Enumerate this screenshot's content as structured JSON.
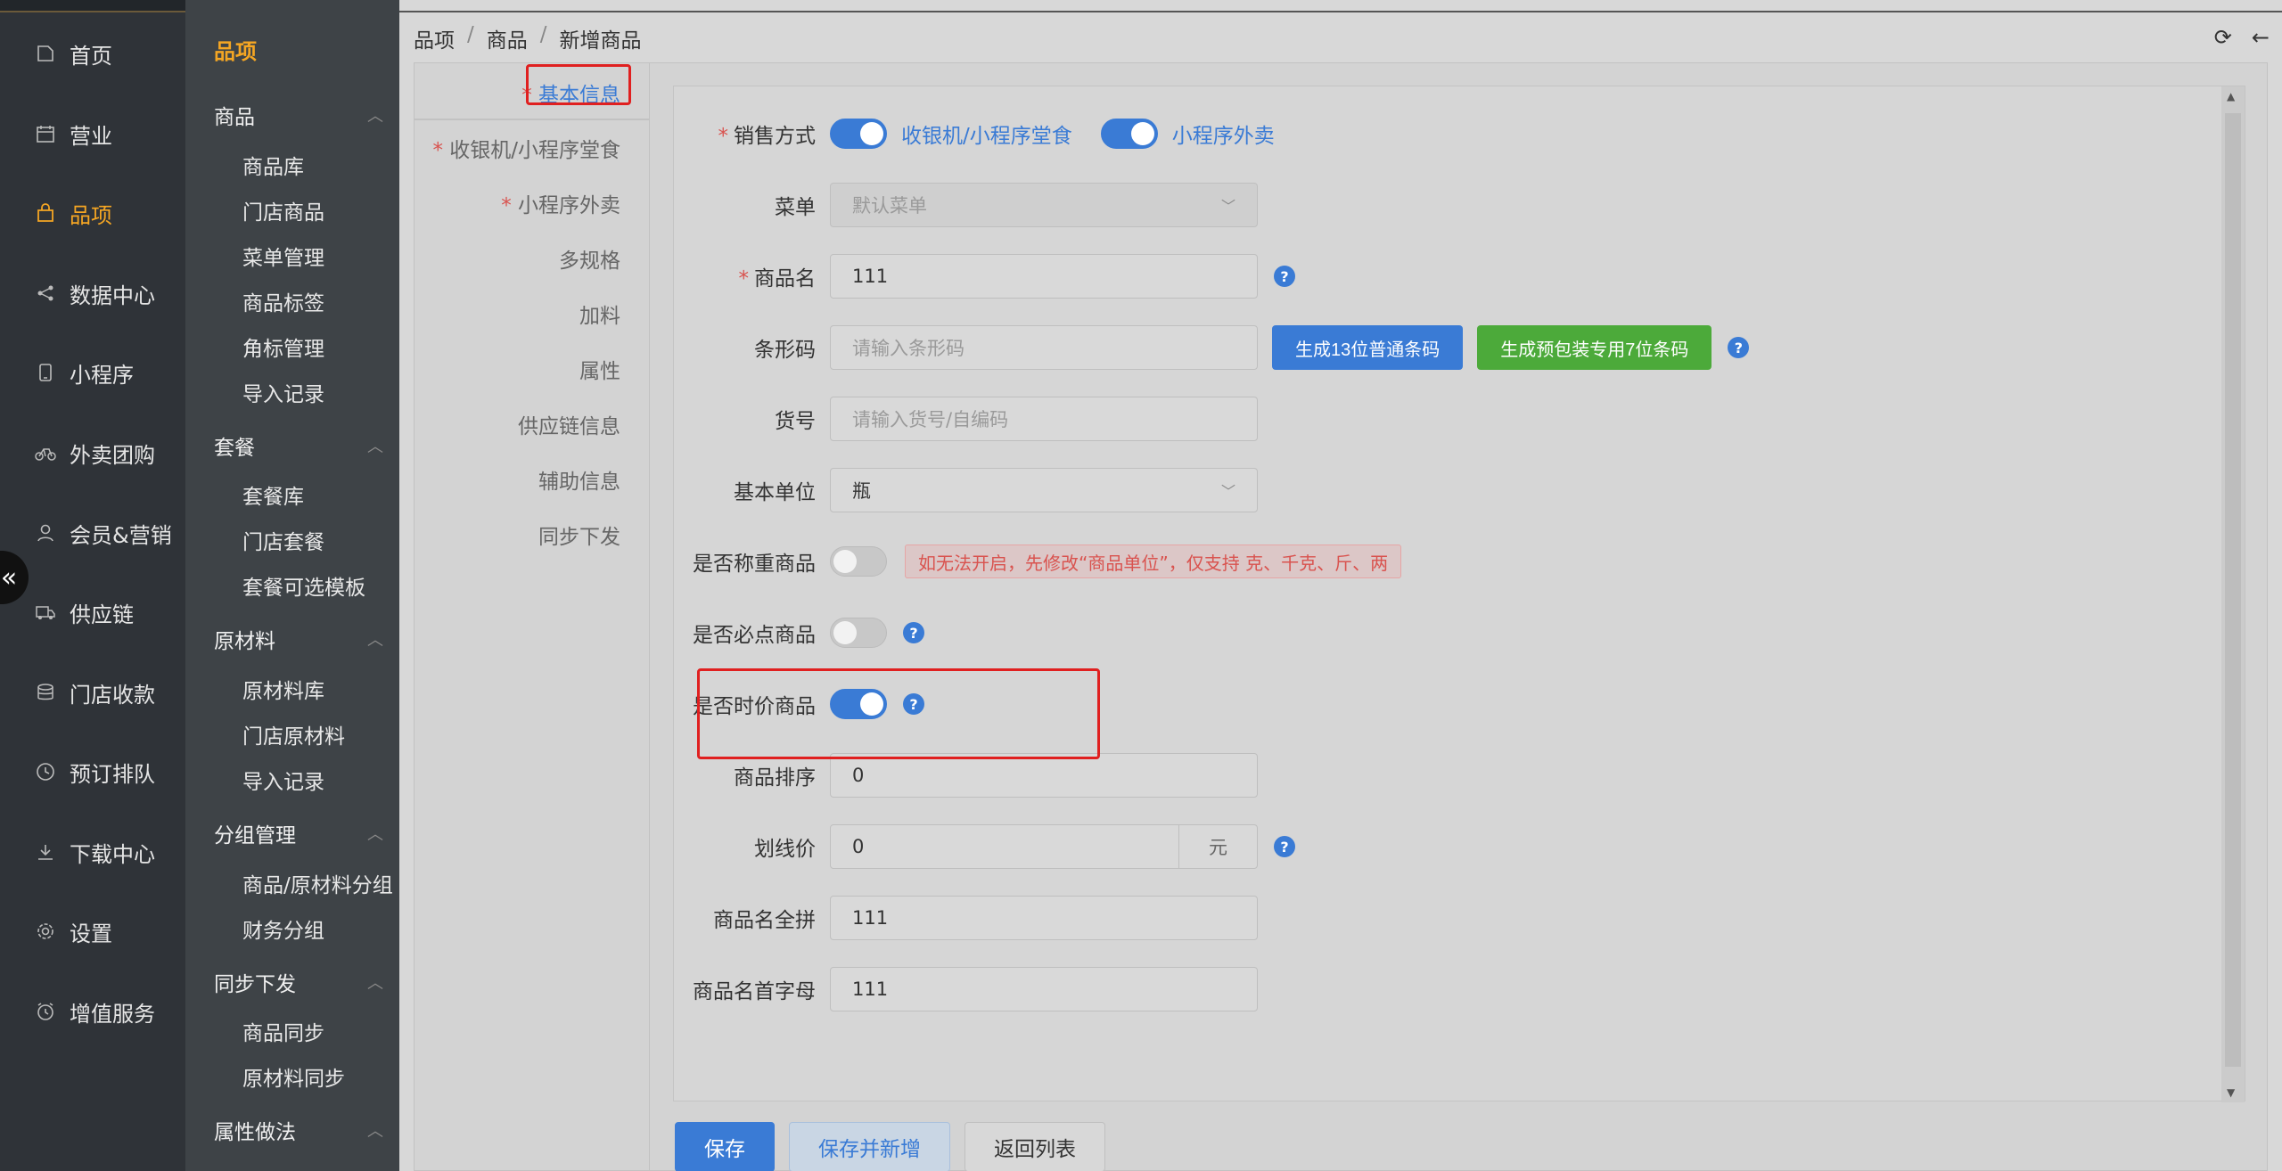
{
  "nav1": {
    "items": [
      {
        "label": "首页",
        "icon": "home-icon"
      },
      {
        "label": "营业",
        "icon": "calendar-icon"
      },
      {
        "label": "品项",
        "icon": "bag-icon"
      },
      {
        "label": "数据中心",
        "icon": "share-icon"
      },
      {
        "label": "小程序",
        "icon": "phone-icon"
      },
      {
        "label": "外卖团购",
        "icon": "bike-icon"
      },
      {
        "label": "会员&营销",
        "icon": "user-icon"
      },
      {
        "label": "供应链",
        "icon": "truck-icon"
      },
      {
        "label": "门店收款",
        "icon": "database-icon"
      },
      {
        "label": "预订排队",
        "icon": "clock-icon"
      },
      {
        "label": "下载中心",
        "icon": "download-icon"
      },
      {
        "label": "设置",
        "icon": "gear-icon"
      },
      {
        "label": "增值服务",
        "icon": "alarm-icon"
      }
    ],
    "collapse": "«"
  },
  "nav2": {
    "title": "品项",
    "groups": {
      "goods": "商品",
      "combo": "套餐",
      "material": "原材料",
      "grouping": "分组管理",
      "sync": "同步下发",
      "attr": "属性做法"
    },
    "items": {
      "goods_lib": "商品库",
      "store_goods": "门店商品",
      "menu_mgmt": "菜单管理",
      "goods_tags": "商品标签",
      "corner_mgmt": "角标管理",
      "import_record": "导入记录",
      "combo_lib": "套餐库",
      "store_combo": "门店套餐",
      "combo_template": "套餐可选模板",
      "material_lib": "原材料库",
      "store_material": "门店原材料",
      "import_record2": "导入记录",
      "goods_material_group": "商品/原材料分组",
      "finance_group": "财务分组",
      "goods_sync": "商品同步",
      "material_sync": "原材料同步"
    }
  },
  "breadcrumb": [
    "品项",
    "商品",
    "新增商品"
  ],
  "tabs": [
    {
      "label": "基本信息",
      "required": true
    },
    {
      "label": "收银机/小程序堂食",
      "required": true
    },
    {
      "label": "小程序外卖",
      "required": true
    },
    {
      "label": "多规格",
      "required": false
    },
    {
      "label": "加料",
      "required": false
    },
    {
      "label": "属性",
      "required": false
    },
    {
      "label": "供应链信息",
      "required": false
    },
    {
      "label": "辅助信息",
      "required": false
    },
    {
      "label": "同步下发",
      "required": false
    }
  ],
  "form": {
    "sale_mode": {
      "label": "销售方式",
      "opt1": "收银机/小程序堂食",
      "opt2": "小程序外卖"
    },
    "menu": {
      "label": "菜单",
      "value": "默认菜单"
    },
    "name": {
      "label": "商品名",
      "value": "111"
    },
    "barcode": {
      "label": "条形码",
      "placeholder": "请输入条形码",
      "btn1": "生成13位普通条码",
      "btn2": "生成预包装专用7位条码"
    },
    "sku": {
      "label": "货号",
      "placeholder": "请输入货号/自编码"
    },
    "unit": {
      "label": "基本单位",
      "value": "瓶"
    },
    "weigh": {
      "label": "是否称重商品",
      "warning": "如无法开启，先修改“商品单位”，仅支持 克、千克、斤、两"
    },
    "must_order": {
      "label": "是否必点商品"
    },
    "time_price": {
      "label": "是否时价商品"
    },
    "sort": {
      "label": "商品排序",
      "value": "0"
    },
    "strike_price": {
      "label": "划线价",
      "value": "0",
      "suffix": "元"
    },
    "pinyin": {
      "label": "商品名全拼",
      "value": "111"
    },
    "initials": {
      "label": "商品名首字母",
      "value": "111"
    }
  },
  "footer": {
    "save": "保存",
    "save_new": "保存并新增",
    "back": "返回列表"
  },
  "colors": {
    "accent": "#3a7bd5",
    "active_nav": "#f5a623",
    "green": "#4caa3a",
    "highlight": "#e02020"
  }
}
